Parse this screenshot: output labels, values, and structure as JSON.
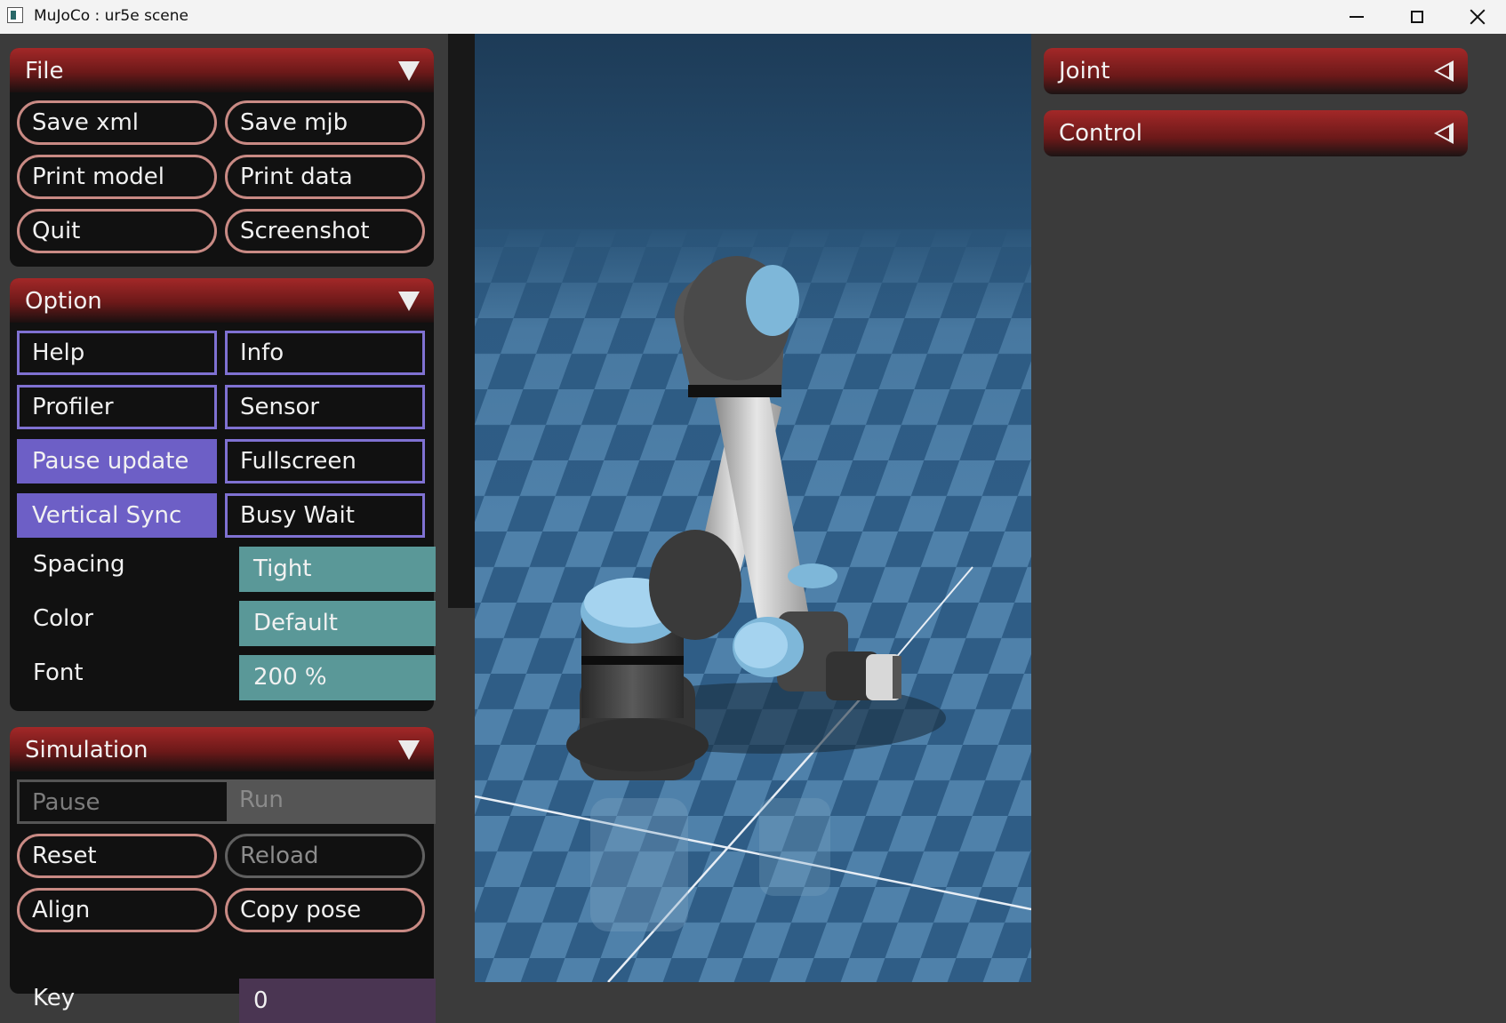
{
  "window": {
    "title": "MuJoCo : ur5e scene",
    "icon": "app-icon",
    "controls": [
      "minimize-icon",
      "maximize-icon",
      "close-icon"
    ]
  },
  "colors": {
    "panel_bg": "#3b3b3b",
    "section_bg": "#111111",
    "header_red": "#a32828",
    "radio_border": "#c98a84",
    "check_border": "#7f71d2",
    "check_on": "#6d5fc6",
    "select_teal": "#5a9898",
    "key_purple": "#4a3552",
    "sky": "#1e4667",
    "floor_tile": "#4f7fa8"
  },
  "file": {
    "title": "File",
    "buttons": [
      "Save xml",
      "Save mjb",
      "Print model",
      "Print data",
      "Quit",
      "Screenshot"
    ]
  },
  "option": {
    "title": "Option",
    "toggles": [
      {
        "label": "Help",
        "on": false
      },
      {
        "label": "Info",
        "on": false
      },
      {
        "label": "Profiler",
        "on": false
      },
      {
        "label": "Sensor",
        "on": false
      },
      {
        "label": "Pause update",
        "on": true
      },
      {
        "label": "Fullscreen",
        "on": false
      },
      {
        "label": "Vertical Sync",
        "on": true
      },
      {
        "label": "Busy Wait",
        "on": false
      }
    ],
    "spacing": {
      "label": "Spacing",
      "value": "Tight"
    },
    "color": {
      "label": "Color",
      "value": "Default"
    },
    "font": {
      "label": "Font",
      "value": "200 %"
    }
  },
  "simulation": {
    "title": "Simulation",
    "pause": "Pause",
    "run": "Run",
    "reset": "Reset",
    "reload": "Reload",
    "align": "Align",
    "copy_pose": "Copy pose",
    "key": {
      "label": "Key",
      "value": "0"
    }
  },
  "right": {
    "joint": "Joint",
    "control": "Control"
  }
}
